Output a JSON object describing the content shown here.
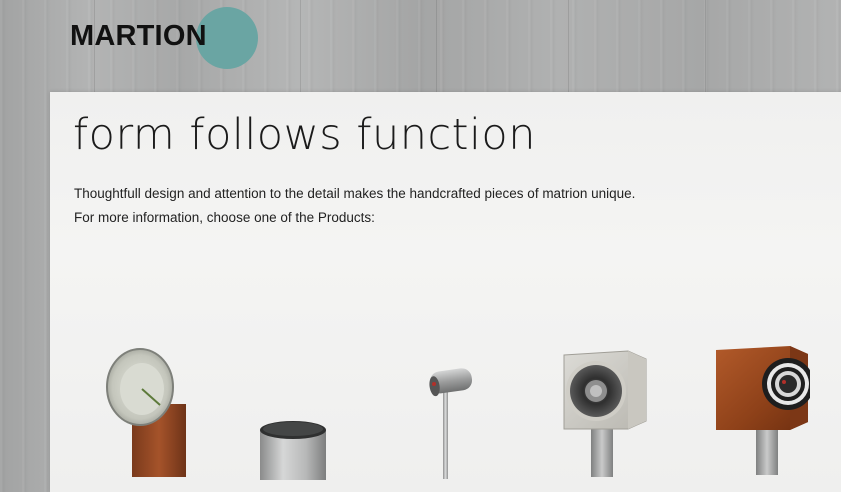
{
  "brand": {
    "logo_text": "MARTION",
    "accent_color": "#6aa5a3"
  },
  "main": {
    "headline": "form follows function",
    "intro_line_1": "Thoughtfull design and attention to the detail makes the handcrafted pieces of matrion unique.",
    "intro_line_2": "For more information, choose one of the Products:"
  },
  "products": [
    {
      "name": "horn-speaker-wood-pedestal",
      "icon": "horn-speaker-icon"
    },
    {
      "name": "cylinder-subwoofer",
      "icon": "cylinder-speaker-icon"
    },
    {
      "name": "tube-speaker-on-stand",
      "icon": "tube-speaker-icon"
    },
    {
      "name": "cube-speaker-silver",
      "icon": "cube-speaker-silver-icon"
    },
    {
      "name": "cube-speaker-wood",
      "icon": "cube-speaker-wood-icon"
    }
  ]
}
